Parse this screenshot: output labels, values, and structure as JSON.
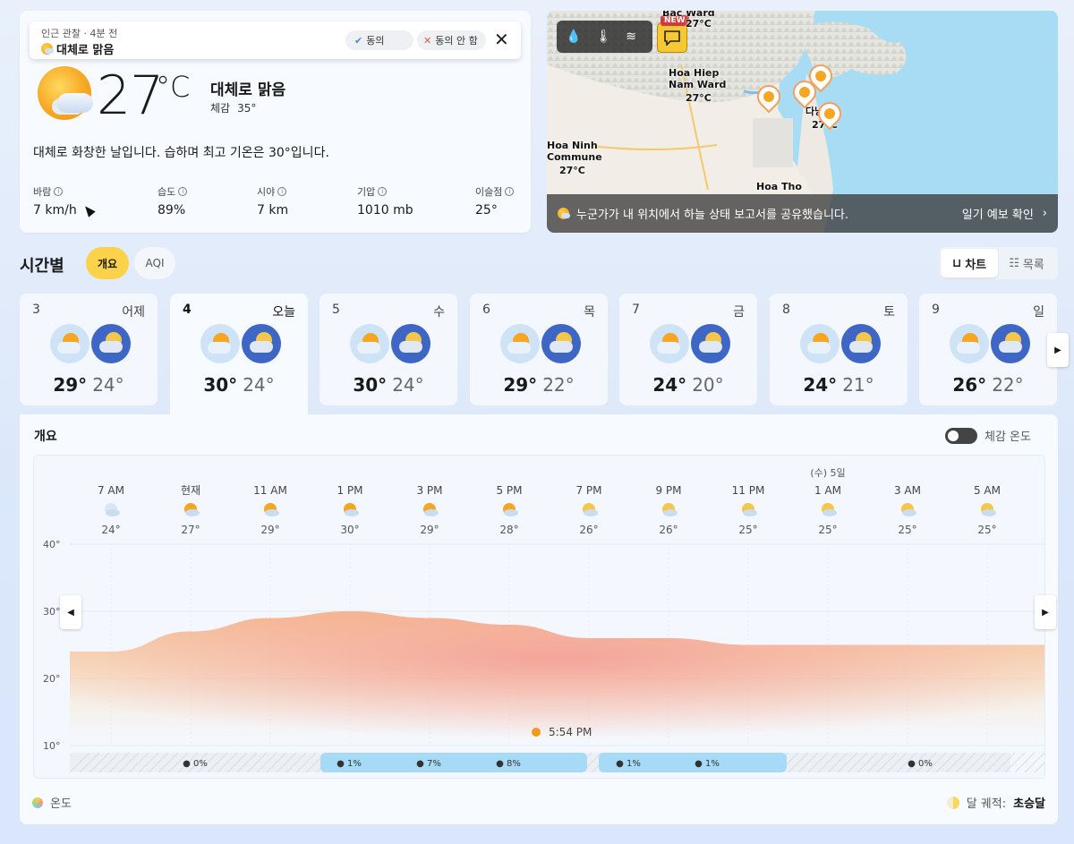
{
  "current": {
    "obs_meta": "인근 관찰 · 4분 전",
    "obs_condition": "대체로 맑음",
    "agree_label": "동의",
    "disagree_label": "동의 안 함",
    "temp": "27",
    "unit": "°C",
    "condition": "대체로 맑음",
    "feels_label": "체감",
    "feels_value": "35°",
    "summary": "대체로 화창한 날입니다. 습하며 최고 기온은 30°입니다.",
    "stats": [
      {
        "label": "바람",
        "value": "7 km/h"
      },
      {
        "label": "습도",
        "value": "89%"
      },
      {
        "label": "시야",
        "value": "7 km"
      },
      {
        "label": "기압",
        "value": "1010 mb"
      },
      {
        "label": "이슬점",
        "value": "25°"
      }
    ]
  },
  "map": {
    "new_badge": "NEW",
    "labels": [
      {
        "text": "Bac Ward",
        "sub": "27°C"
      },
      {
        "text": "Hoa Hiep",
        "sub": "Nam Ward"
      },
      {
        "text": "27°C"
      },
      {
        "text": "다낭"
      },
      {
        "text": "27°C"
      },
      {
        "text": "Hoa Ninh"
      },
      {
        "text": "Commune"
      },
      {
        "text": "27°C"
      },
      {
        "text": "Hoa Tho"
      }
    ],
    "footer_msg": "누군가가 내 위치에서 하늘 상태 보고서를 공유했습니다.",
    "footer_link": "일기 예보 확인"
  },
  "hourly": {
    "title": "시간별",
    "tabs": [
      "개요",
      "AQI"
    ],
    "views": [
      "차트",
      "목록"
    ]
  },
  "days": [
    {
      "num": "3",
      "name": "어제",
      "hi": "29°",
      "lo": "24°"
    },
    {
      "num": "4",
      "name": "오늘",
      "hi": "30°",
      "lo": "24°"
    },
    {
      "num": "5",
      "name": "수",
      "hi": "30°",
      "lo": "24°"
    },
    {
      "num": "6",
      "name": "목",
      "hi": "29°",
      "lo": "22°"
    },
    {
      "num": "7",
      "name": "금",
      "hi": "24°",
      "lo": "20°"
    },
    {
      "num": "8",
      "name": "토",
      "hi": "24°",
      "lo": "21°"
    },
    {
      "num": "9",
      "name": "일",
      "hi": "26°",
      "lo": "22°"
    }
  ],
  "chart_panel": {
    "title": "개요",
    "feels_toggle_label": "체감 온도",
    "legend_label": "온도",
    "moon_label": "달 궤적:",
    "moon_phase": "초승달",
    "sunset_label": "5:54 PM"
  },
  "chart_data": {
    "type": "area",
    "title": "",
    "xlabel": "",
    "ylabel": "",
    "ylim": [
      10,
      40
    ],
    "yticks": [
      "40°",
      "30°",
      "20°",
      "10°"
    ],
    "day_marker": "(수) 5일",
    "x": [
      "7 AM",
      "현재",
      "11 AM",
      "1 PM",
      "3 PM",
      "5 PM",
      "7 PM",
      "9 PM",
      "11 PM",
      "1 AM",
      "3 AM",
      "5 AM"
    ],
    "series": [
      {
        "values": [
          24,
          27,
          29,
          30,
          29,
          28,
          26,
          26,
          25,
          25,
          25,
          25
        ]
      }
    ],
    "temp_labels": [
      "24°",
      "27°",
      "29°",
      "30°",
      "29°",
      "28°",
      "26°",
      "26°",
      "25°",
      "25°",
      "25°",
      "25°"
    ],
    "precip": [
      {
        "label": "0%"
      },
      {
        "label": "1%"
      },
      {
        "label": "7%"
      },
      {
        "label": "8%"
      },
      {
        "label": "1%"
      },
      {
        "label": "1%"
      },
      {
        "label": "0%"
      }
    ]
  }
}
